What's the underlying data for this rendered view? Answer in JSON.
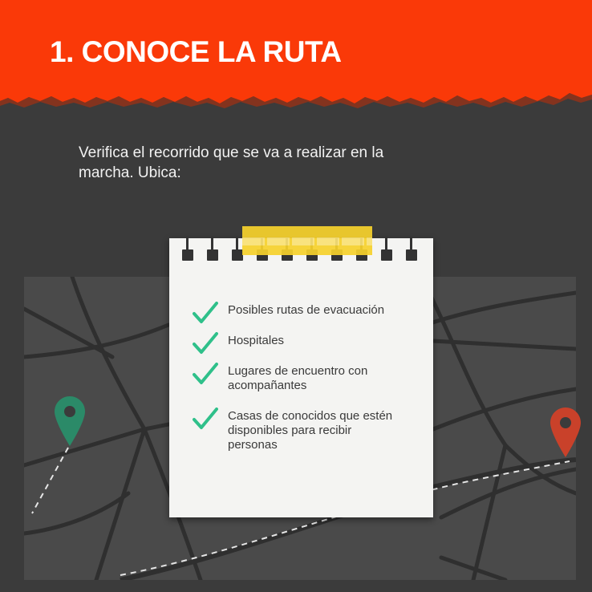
{
  "header": {
    "title": "1. CONOCE LA RUTA",
    "accent_color": "#fa3908"
  },
  "intro": {
    "text": "Verifica el recorrido que se va a realizar en la marcha. Ubica:"
  },
  "note": {
    "items": [
      {
        "text": "Posibles rutas de evacuación",
        "icon": "check-icon"
      },
      {
        "text": "Hospitales",
        "icon": "check-icon"
      },
      {
        "text": "Lugares de encuentro con acompañantes",
        "icon": "check-icon"
      },
      {
        "text": "Casas de conocidos que estén disponibles para recibir personas",
        "icon": "check-icon"
      }
    ],
    "check_color": "#2fc08a",
    "tape_color": "#f7d22c"
  },
  "map": {
    "start_pin_color": "#2b8a68",
    "end_pin_color": "#c9412a",
    "start_icon": "map-pin-icon",
    "end_icon": "map-pin-icon"
  }
}
